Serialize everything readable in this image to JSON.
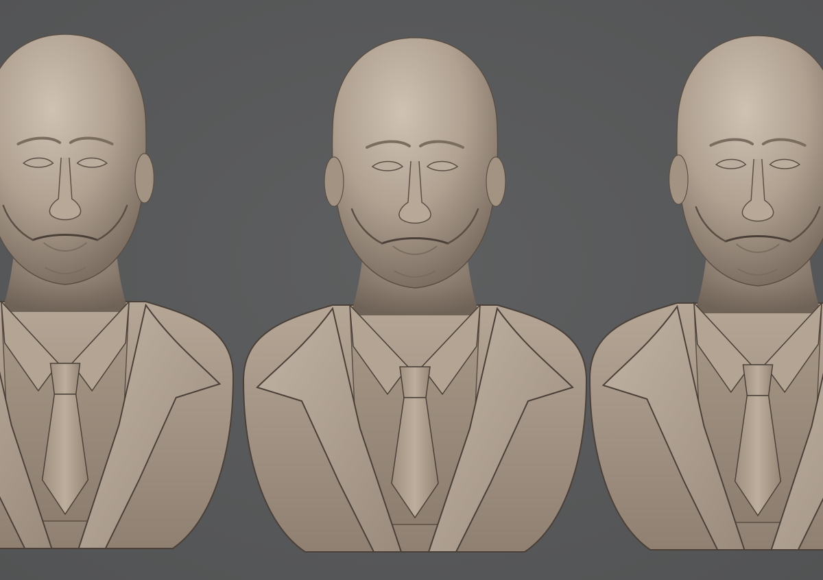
{
  "colors": {
    "background": "#58595a",
    "clay_light": "#c4b6a7",
    "clay_mid": "#a89888",
    "clay_dark": "#6e6155",
    "clay_shadow": "#4a4038"
  },
  "views": [
    {
      "angle": "three-quarter-left"
    },
    {
      "angle": "front"
    },
    {
      "angle": "three-quarter-right"
    }
  ]
}
